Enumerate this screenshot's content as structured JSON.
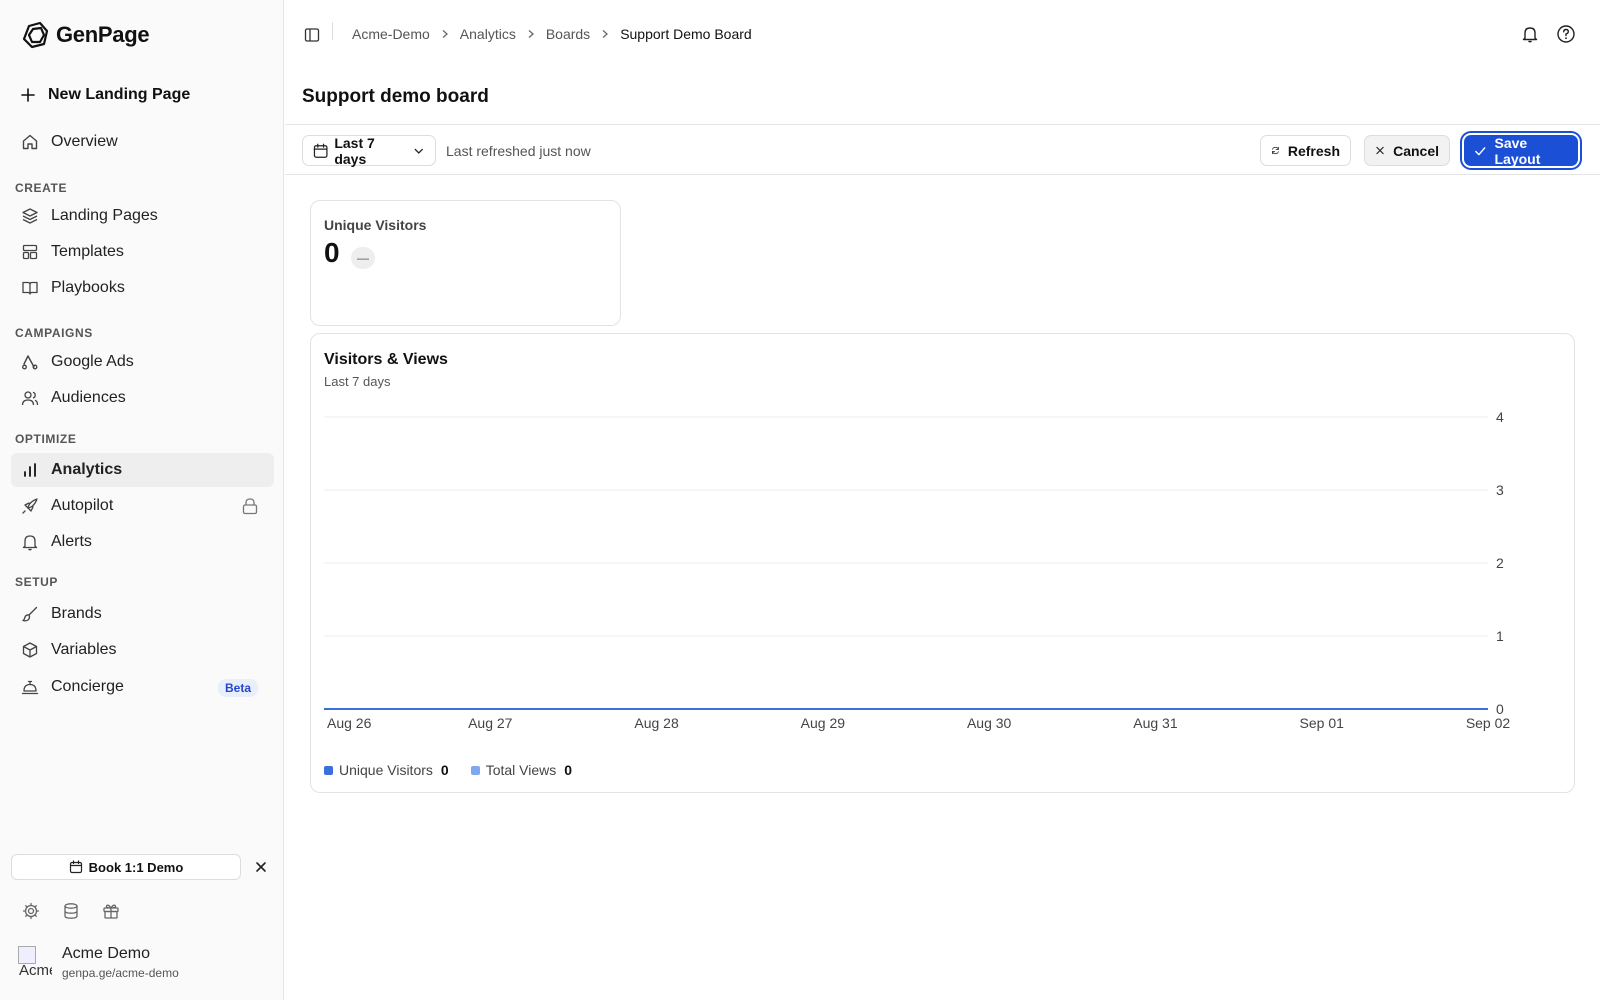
{
  "app": {
    "brand_name": "GenPage"
  },
  "sidebar": {
    "new_page_label": "New Landing Page",
    "overview_label": "Overview",
    "sections": {
      "create": "CREATE",
      "campaigns": "CAMPAIGNS",
      "optimize": "OPTIMIZE",
      "setup": "SETUP"
    },
    "items": {
      "landing_pages": "Landing Pages",
      "templates": "Templates",
      "playbooks": "Playbooks",
      "google_ads": "Google Ads",
      "audiences": "Audiences",
      "analytics": "Analytics",
      "autopilot": "Autopilot",
      "alerts": "Alerts",
      "brands": "Brands",
      "variables": "Variables",
      "concierge": "Concierge"
    },
    "beta_badge": "Beta",
    "demo_button": "Book 1:1 Demo",
    "account": {
      "name": "Acme Demo",
      "url": "genpa.ge/acme-demo",
      "avatar_alt": "Acme"
    }
  },
  "header": {
    "breadcrumb": [
      "Acme-Demo",
      "Analytics",
      "Boards",
      "Support Demo Board"
    ],
    "breadcrumb_separator": ">",
    "page_title": "Support demo board"
  },
  "toolbar": {
    "date_range": "Last 7 days",
    "last_refreshed": "Last refreshed just now",
    "refresh_label": "Refresh",
    "cancel_label": "Cancel",
    "save_label": "Save Layout"
  },
  "kpi": {
    "label": "Unique Visitors",
    "value": "0",
    "change": "—"
  },
  "colors": {
    "accent": "#1a4fd6",
    "series_unique": "#3b6fe0",
    "series_views": "#7fa8f0"
  },
  "chart_data": {
    "type": "line",
    "title": "Visitors & Views",
    "subtitle": "Last 7 days",
    "x": [
      "Aug 26",
      "Aug 27",
      "Aug 28",
      "Aug 29",
      "Aug 30",
      "Aug 31",
      "Sep 01",
      "Sep 02"
    ],
    "series": [
      {
        "name": "Unique Visitors",
        "values": [
          0,
          0,
          0,
          0,
          0,
          0,
          0,
          0
        ],
        "total": "0"
      },
      {
        "name": "Total Views",
        "values": [
          0,
          0,
          0,
          0,
          0,
          0,
          0,
          0
        ],
        "total": "0"
      }
    ],
    "ylim": [
      0,
      4
    ],
    "yticks": [
      0,
      1,
      2,
      3,
      4
    ],
    "y_axis_side": "right",
    "grid": true,
    "legend_position": "bottom-left"
  }
}
